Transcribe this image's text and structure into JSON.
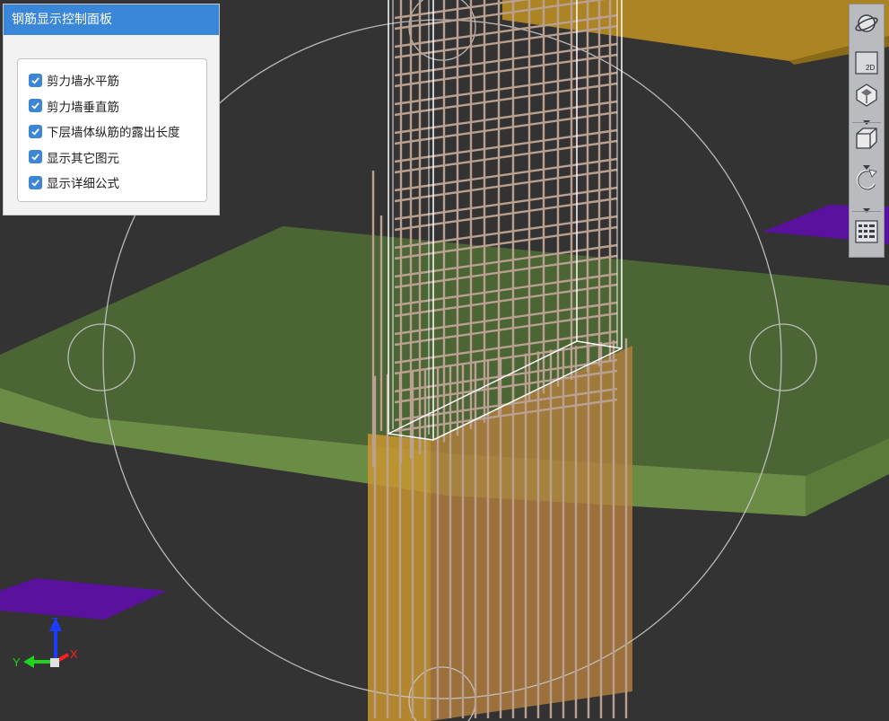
{
  "panel": {
    "title": "钢筋显示控制面板",
    "options": [
      {
        "label": "剪力墙水平筋",
        "checked": true
      },
      {
        "label": "剪力墙垂直筋",
        "checked": true
      },
      {
        "label": "下层墙体纵筋的露出长度",
        "checked": true
      },
      {
        "label": "显示其它图元",
        "checked": true
      },
      {
        "label": "显示详细公式",
        "checked": true
      }
    ]
  },
  "toolbar": {
    "buttons": [
      {
        "name": "orbit-icon"
      },
      {
        "name": "2d-view-icon",
        "label": "2D"
      },
      {
        "name": "view-cube-icon"
      },
      {
        "name": "box-view-icon"
      },
      {
        "name": "rotate-icon"
      },
      {
        "name": "layer-panel-icon"
      }
    ]
  },
  "axes": {
    "x": "X",
    "y": "Y",
    "z": "Z"
  },
  "colors": {
    "background": "#333333",
    "slab": "#5f7d3e",
    "wall": "#b88a4e",
    "beam": "#b98d22",
    "purple_plate": "#5a129e",
    "panel_header": "#3a86d8",
    "checkbox": "#3d86d6"
  }
}
